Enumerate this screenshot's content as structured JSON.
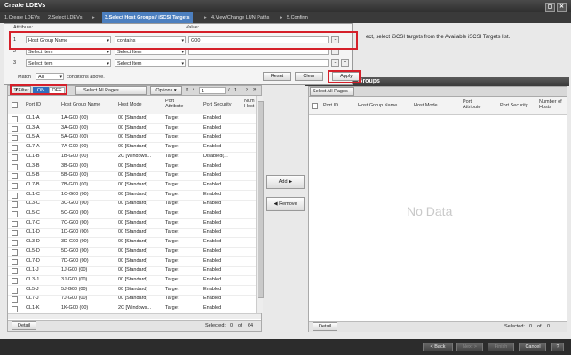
{
  "window": {
    "title": "Create LDEVs"
  },
  "steps": [
    "1.Create LDEVs",
    "2.Select LDEVs",
    "3.Select Host Groups / iSCSI Targets",
    "4.View/Change LUN Paths",
    "5.Confirm"
  ],
  "instruction": "ect, select iSCSI targets from the Available iSCSI Targets list.",
  "filter": {
    "attribute_label": "Attribute:",
    "value_label": "Value:",
    "rows": [
      {
        "num": "1",
        "attribute": "Host Group Name",
        "operator": "contains",
        "value": "G00"
      },
      {
        "num": "2",
        "attribute": "Select Item",
        "operator": "Select Item",
        "value": ""
      },
      {
        "num": "3",
        "attribute": "Select Item",
        "operator": "Select Item",
        "value": ""
      }
    ],
    "match_label": "Match",
    "match_value": "All",
    "conditions_text": "conditions above.",
    "reset": "Reset",
    "clear": "Clear",
    "apply": "Apply"
  },
  "left": {
    "filter_btn": "Filter",
    "on": "ON",
    "off": "OFF",
    "select_all": "Select All Pages",
    "options": "Options",
    "page_current": "1",
    "page_total": "1",
    "columns": [
      "Port ID",
      "Host Group Name",
      "Host Mode",
      "Port Attribute",
      "Port Security",
      "Num Host"
    ],
    "rows": [
      [
        "CL1-A",
        "1A-G00 (00)",
        "00 [Standard]",
        "Target",
        "Enabled"
      ],
      [
        "CL3-A",
        "3A-G00 (00)",
        "00 [Standard]",
        "Target",
        "Enabled"
      ],
      [
        "CL5-A",
        "5A-G00 (00)",
        "00 [Standard]",
        "Target",
        "Enabled"
      ],
      [
        "CL7-A",
        "7A-G00 (00)",
        "00 [Standard]",
        "Target",
        "Enabled"
      ],
      [
        "CL1-B",
        "1B-G00 (00)",
        "2C [Windows...",
        "Target",
        "Disabled(..."
      ],
      [
        "CL3-B",
        "3B-G00 (00)",
        "00 [Standard]",
        "Target",
        "Enabled"
      ],
      [
        "CL5-B",
        "5B-G00 (00)",
        "00 [Standard]",
        "Target",
        "Enabled"
      ],
      [
        "CL7-B",
        "7B-G00 (00)",
        "00 [Standard]",
        "Target",
        "Enabled"
      ],
      [
        "CL1-C",
        "1C-G00 (00)",
        "00 [Standard]",
        "Target",
        "Enabled"
      ],
      [
        "CL3-C",
        "3C-G00 (00)",
        "00 [Standard]",
        "Target",
        "Enabled"
      ],
      [
        "CL5-C",
        "5C-G00 (00)",
        "00 [Standard]",
        "Target",
        "Enabled"
      ],
      [
        "CL7-C",
        "7C-G00 (00)",
        "00 [Standard]",
        "Target",
        "Enabled"
      ],
      [
        "CL1-D",
        "1D-G00 (00)",
        "00 [Standard]",
        "Target",
        "Enabled"
      ],
      [
        "CL3-D",
        "3D-G00 (00)",
        "00 [Standard]",
        "Target",
        "Enabled"
      ],
      [
        "CL5-D",
        "5D-G00 (00)",
        "00 [Standard]",
        "Target",
        "Enabled"
      ],
      [
        "CL7-D",
        "7D-G00 (00)",
        "00 [Standard]",
        "Target",
        "Enabled"
      ],
      [
        "CL1-J",
        "1J-G00 (00)",
        "00 [Standard]",
        "Target",
        "Enabled"
      ],
      [
        "CL3-J",
        "3J-G00 (00)",
        "00 [Standard]",
        "Target",
        "Enabled"
      ],
      [
        "CL5-J",
        "5J-G00 (00)",
        "00 [Standard]",
        "Target",
        "Enabled"
      ],
      [
        "CL7-J",
        "7J-G00 (00)",
        "00 [Standard]",
        "Target",
        "Enabled"
      ],
      [
        "CL1-K",
        "1K-G00 (00)",
        "2C [Windows...",
        "Target",
        "Enabled"
      ]
    ],
    "detail": "Detail",
    "selected_label": "Selected:",
    "selected_count": "0",
    "of_label": "of",
    "total": "64"
  },
  "middle": {
    "add": "Add",
    "remove": "Remove"
  },
  "right": {
    "header_suffix": "Groups",
    "select_all": "Select All Pages",
    "columns": [
      "Port ID",
      "Host Group Name",
      "Host Mode",
      "Port Attribute",
      "Port Security",
      "Number of Hosts"
    ],
    "no_data": "No Data",
    "detail": "Detail",
    "selected_label": "Selected:",
    "selected_count": "0",
    "of_label": "of",
    "total": "0"
  },
  "footer": {
    "back": "< Back",
    "next": "Next >",
    "finish": "Finish",
    "cancel": "Cancel",
    "help": "?"
  }
}
